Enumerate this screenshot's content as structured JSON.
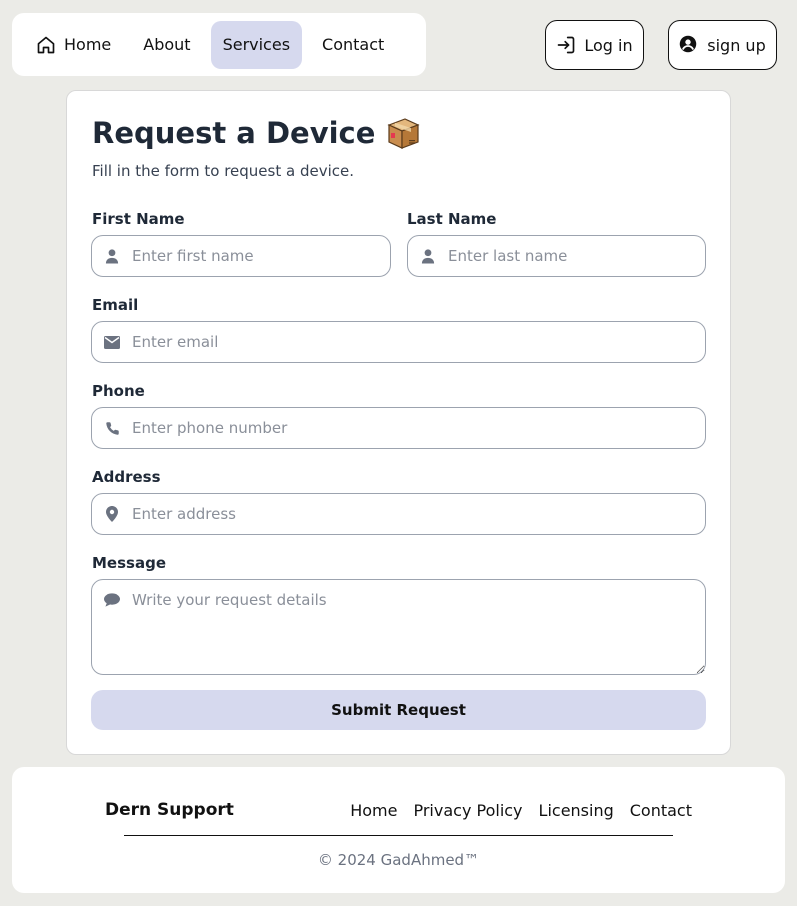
{
  "nav": {
    "items": [
      {
        "label": "Home",
        "icon": "home-icon"
      },
      {
        "label": "About"
      },
      {
        "label": "Services",
        "active": true
      },
      {
        "label": "Contact"
      }
    ],
    "login_label": "Log in",
    "signup_label": "sign up",
    "active_color": "#d6d9ee"
  },
  "form": {
    "title": "Request a Device",
    "title_icon": "package-box-icon",
    "subtitle": "Fill in the form to request a device.",
    "fields": {
      "first_name": {
        "label": "First Name",
        "placeholder": "Enter first name",
        "icon": "user-icon"
      },
      "last_name": {
        "label": "Last Name",
        "placeholder": "Enter last name",
        "icon": "user-icon"
      },
      "email": {
        "label": "Email",
        "placeholder": "Enter email",
        "icon": "envelope-icon"
      },
      "phone": {
        "label": "Phone",
        "placeholder": "Enter phone number",
        "icon": "phone-icon"
      },
      "address": {
        "label": "Address",
        "placeholder": "Enter address",
        "icon": "map-pin-icon"
      },
      "message": {
        "label": "Message",
        "placeholder": "Write your request details",
        "icon": "speech-bubble-icon"
      }
    },
    "submit_label": "Submit Request"
  },
  "footer": {
    "brand": "Dern Support",
    "links": [
      "Home",
      "Privacy Policy",
      "Licensing",
      "Contact"
    ],
    "copyright": "© 2024 GadAhmed™"
  }
}
